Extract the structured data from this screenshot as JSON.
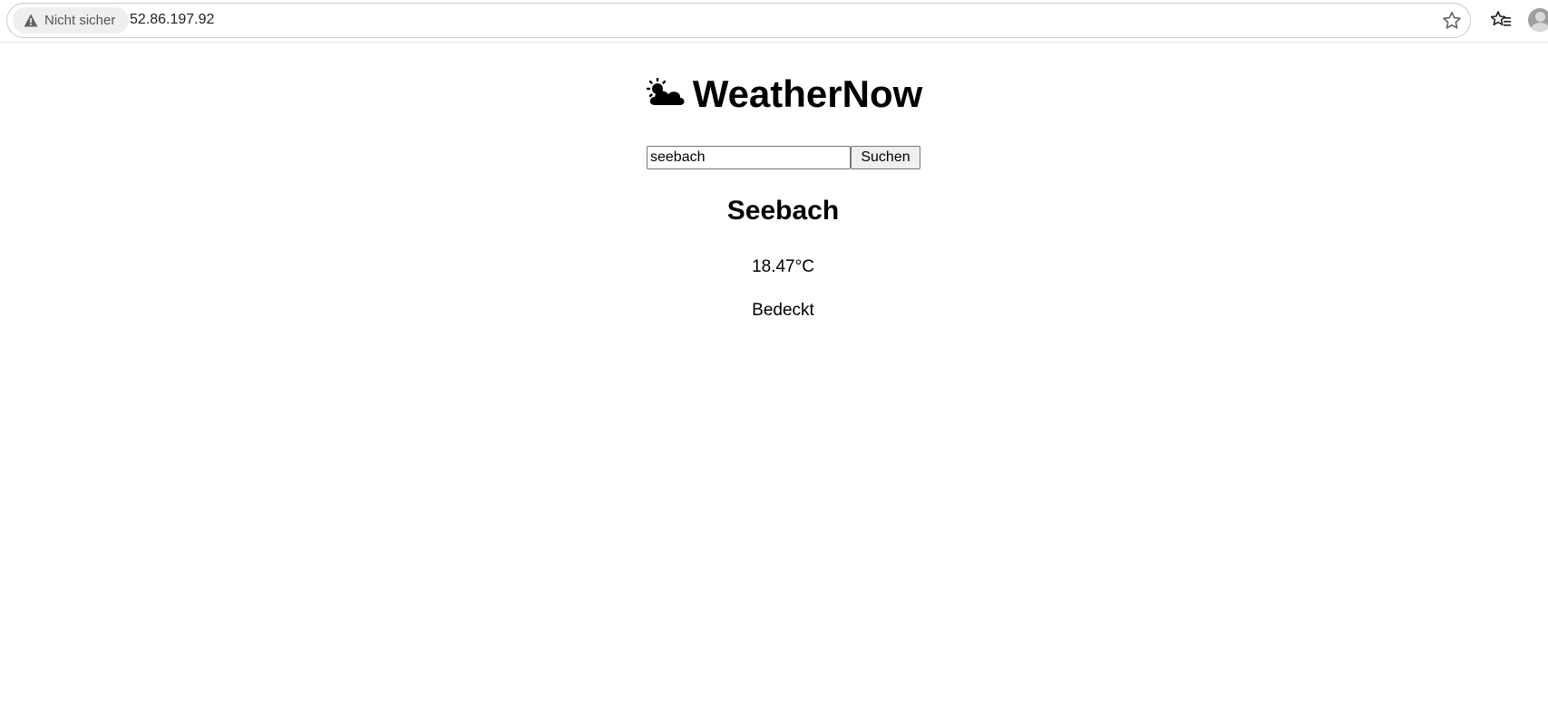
{
  "browser": {
    "security_label": "Nicht sicher",
    "url": "52.86.197.92"
  },
  "app": {
    "title": "WeatherNow",
    "title_icon": "sun-behind-cloud-icon"
  },
  "search": {
    "value": "seebach",
    "button_label": "Suchen"
  },
  "weather": {
    "city": "Seebach",
    "temperature": "18.47°C",
    "condition": "Bedeckt"
  }
}
